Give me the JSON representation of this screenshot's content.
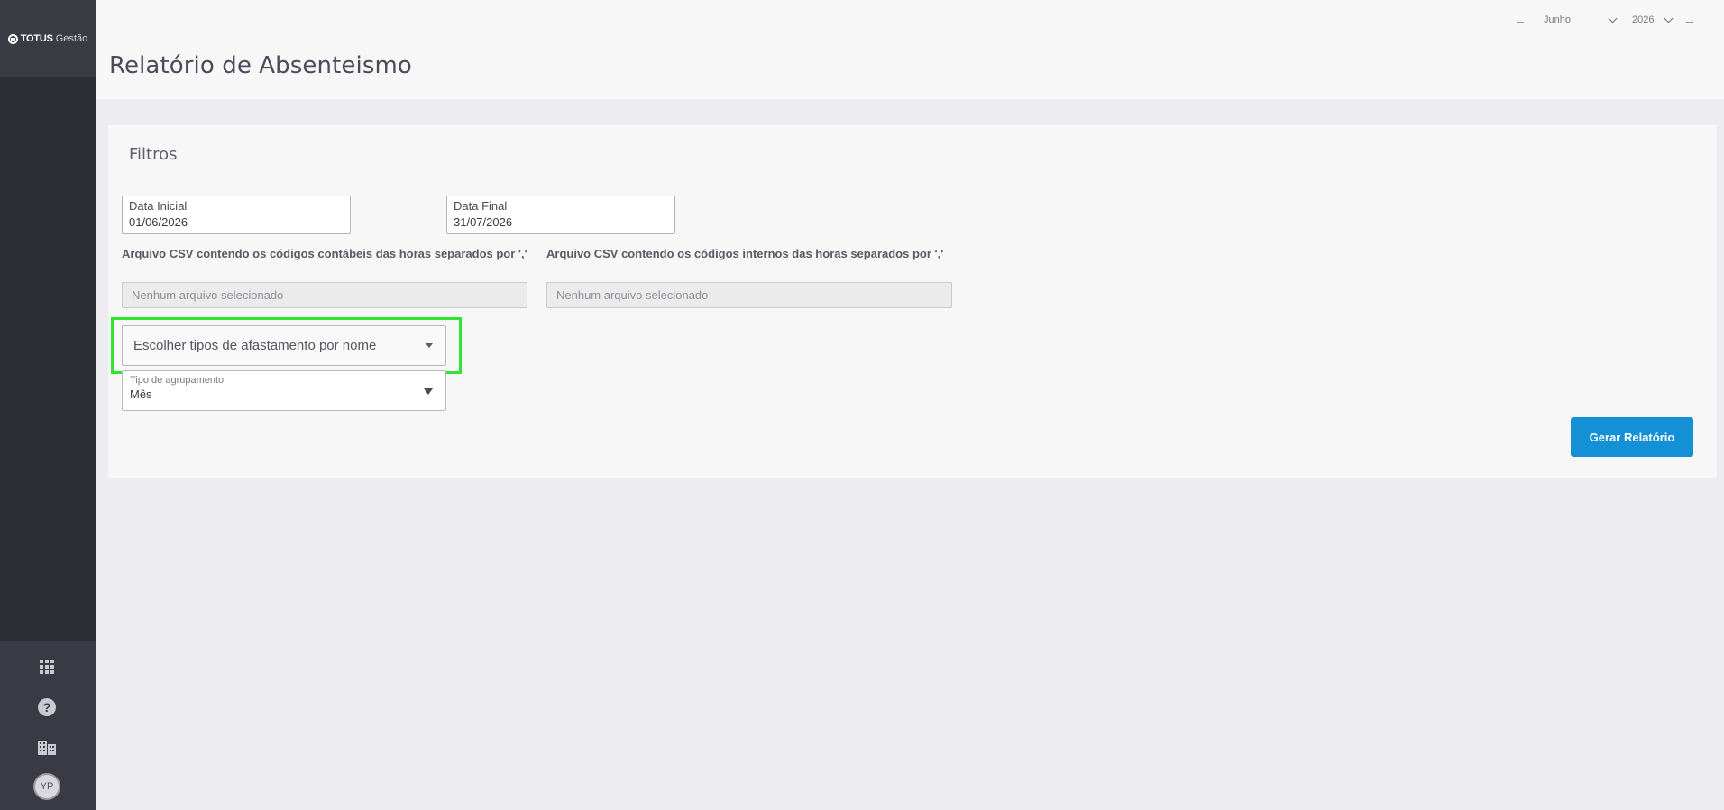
{
  "app": {
    "logo_brand": "TOTUS",
    "logo_product": "Gestão"
  },
  "header": {
    "title": "Relatório de Absenteismo",
    "period": {
      "month": "Junho",
      "year": "2026"
    }
  },
  "sidebar": {
    "avatar_initials": "YP",
    "icons": [
      "apps-grid-icon",
      "help-icon",
      "building-icon"
    ]
  },
  "filters": {
    "title": "Filtros",
    "start_date": {
      "label": "Data Inicial",
      "value": "01/06/2026"
    },
    "end_date": {
      "label": "Data Final",
      "value": "31/07/2026"
    },
    "csv_accounting": {
      "label": "Arquivo CSV contendo os códigos contábeis das horas separados por ','",
      "placeholder": "Nenhum arquivo selecionado"
    },
    "csv_internal": {
      "label": "Arquivo CSV contendo os códigos internos das horas separados por ','",
      "placeholder": "Nenhum arquivo selecionado"
    },
    "absence_types": {
      "placeholder": "Escolher tipos de afastamento por nome"
    },
    "grouping": {
      "label": "Tipo de agrupamento",
      "value": "Mês"
    },
    "generate_button": "Gerar Relatório"
  },
  "colors": {
    "accent": "#1491d6",
    "highlight": "#2fe62f",
    "sidebar": "#2c2d35"
  }
}
